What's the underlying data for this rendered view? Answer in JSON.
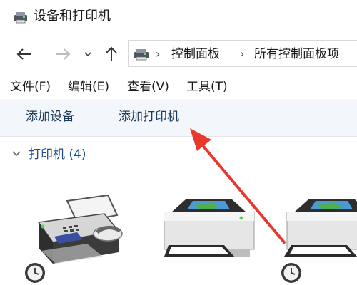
{
  "window": {
    "title": "设备和打印机",
    "title_icon": "devices-printers-icon"
  },
  "navigation": {
    "back_icon": "arrow-left-icon",
    "forward_icon": "arrow-right-icon",
    "recent_icon": "chevron-down-icon",
    "up_icon": "arrow-up-icon",
    "address": {
      "icon": "devices-printers-icon",
      "separator": "›",
      "breadcrumbs": [
        "控制面板",
        "所有控制面板项"
      ]
    }
  },
  "menu": {
    "items": [
      "文件(F)",
      "编辑(E)",
      "查看(V)",
      "工具(T)"
    ]
  },
  "toolbar": {
    "add_device": "添加设备",
    "add_printer": "添加打印机"
  },
  "group": {
    "label": "打印机 (4)",
    "expanded": true
  },
  "devices": [
    {
      "icon": "fax-machine-icon",
      "default_badge": false,
      "status_icon": "clock-icon"
    },
    {
      "icon": "printer-icon",
      "default_badge": false
    },
    {
      "icon": "printer-icon",
      "default_badge": false,
      "status_icon": "clock-icon"
    }
  ],
  "annotation": {
    "type": "red-arrow",
    "points_to": "添加打印机",
    "color": "#e8392f"
  },
  "colors": {
    "command_bar_bg": "#f3f6fa",
    "group_label": "#1e4f8c",
    "arrow": "#e8392f"
  }
}
